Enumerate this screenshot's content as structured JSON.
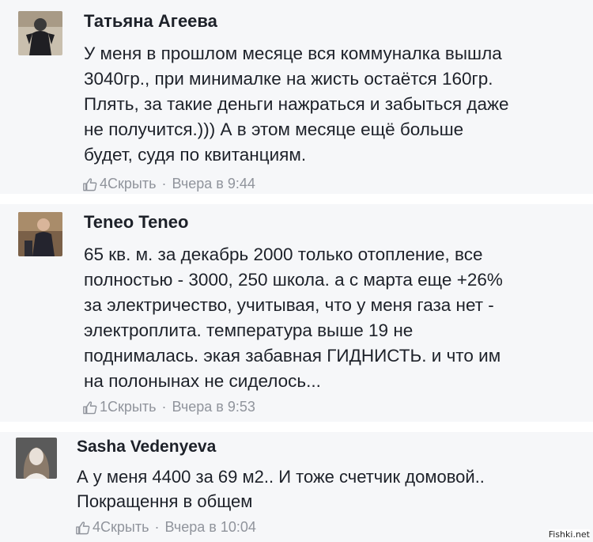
{
  "comments": [
    {
      "author": "Татьяна Агеева",
      "lines": [
        "У меня в прошлом месяце вся коммуналка вышла",
        "3040гр., при минималке на жисть остаётся 160гр.",
        "Плять, за такие деньги нажраться и забыться даже",
        "не получится.))) А в этом месяце ещё больше",
        "будет, судя по квитанциям."
      ],
      "likes": "4",
      "hide_label": "Скрыть",
      "separator": "·",
      "time": "Вчера в 9:44"
    },
    {
      "author": "Teneo Teneo",
      "lines": [
        "65 кв. м. за декабрь 2000 только отопление, все",
        "полностью - 3000, 250 школа. а с марта еще +26%",
        "за электричество, учитывая, что у меня газа нет -",
        "электроплита. температура выше 19 не",
        "поднималась. экая забавная ГИДНИСТЬ. и что им",
        "на полонынах не сиделось..."
      ],
      "likes": "1",
      "hide_label": "Скрыть",
      "separator": "·",
      "time": "Вчера в 9:53"
    },
    {
      "author": "Sasha Vedenyeva",
      "lines": [
        "А у меня 4400 за 69 м2.. И тоже счетчик домовой..",
        "Покращення в общем"
      ],
      "likes": "4",
      "hide_label": "Скрыть",
      "separator": "·",
      "time": "Вчера в 10:04"
    }
  ],
  "watermark": "Fishki.net",
  "icons": {
    "like": "thumbs-up-icon"
  },
  "colors": {
    "text": "#1d2129",
    "meta": "#90949c",
    "panel": "#f6f7f9"
  }
}
